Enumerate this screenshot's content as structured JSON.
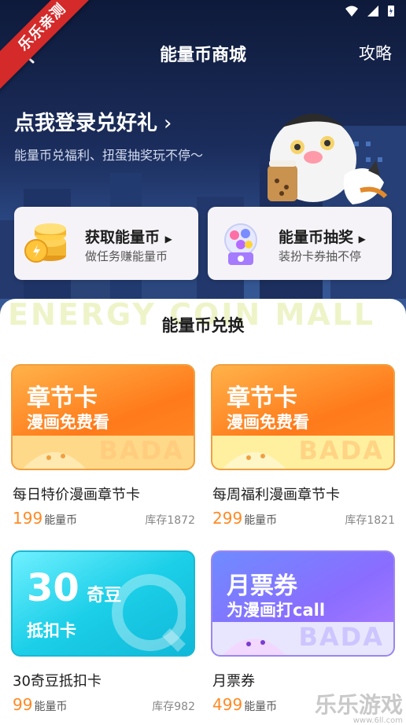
{
  "watermark": {
    "ribbon": "乐乐亲测",
    "corner": "乐乐游戏",
    "corner_url": "www.6ll.com"
  },
  "header": {
    "title": "能量币商城",
    "strategy_label": "攻略"
  },
  "login": {
    "title": "点我登录兑好礼",
    "subtitle": "能量币兑福利、扭蛋抽奖玩不停～"
  },
  "actions": [
    {
      "title": "获取能量币",
      "subtitle": "做任务赚能量币",
      "icon": "coin-stack-icon"
    },
    {
      "title": "能量币抽奖",
      "subtitle": "装扮卡券抽不停",
      "icon": "gacha-machine-icon"
    }
  ],
  "exchange": {
    "bg_text": "ENERGY COIN MALL",
    "title": "能量币兑换",
    "unit": "能量币",
    "products": [
      {
        "card_title": "章节卡",
        "card_subtitle": "漫画免费看",
        "card_brand": "BADA",
        "name": "每日特价漫画章节卡",
        "price": "199",
        "stock": "库存1872"
      },
      {
        "card_title": "章节卡",
        "card_subtitle": "漫画免费看",
        "card_brand": "BADA",
        "name": "每周福利漫画章节卡",
        "price": "299",
        "stock": "库存1821"
      },
      {
        "card_big": "30",
        "card_title": "奇豆",
        "card_subtitle": "抵扣卡",
        "name": "30奇豆抵扣卡",
        "price": "99",
        "stock": "库存982"
      },
      {
        "card_title": "月票券",
        "card_subtitle": "为漫画打call",
        "card_brand": "BADA",
        "name": "月票券",
        "price": "499"
      }
    ]
  },
  "colors": {
    "price": "#ff8a24",
    "hero_bg": "#1b2d5c"
  }
}
